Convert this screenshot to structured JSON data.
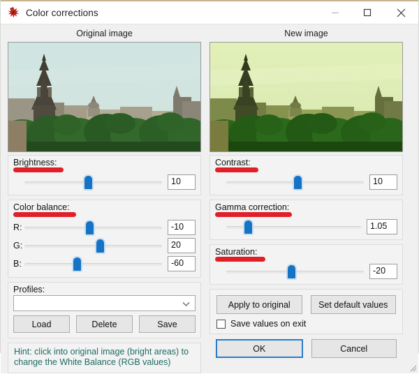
{
  "window": {
    "title": "Color corrections",
    "app_icon": "splat-icon",
    "minimize_label": "Minimize",
    "maximize_label": "Maximize",
    "close_label": "Close"
  },
  "previews": {
    "original_caption": "Original image",
    "new_caption": "New image"
  },
  "adjustments": {
    "brightness": {
      "label": "Brightness:",
      "value": "10",
      "thumb_pct": 46
    },
    "color_balance": {
      "label": "Color balance:",
      "channels": [
        {
          "label": "R:",
          "value": "-10",
          "thumb_pct": 47
        },
        {
          "label": "G:",
          "value": "20",
          "thumb_pct": 55
        },
        {
          "label": "B:",
          "value": "-60",
          "thumb_pct": 38
        }
      ]
    },
    "contrast": {
      "label": "Contrast:",
      "value": "10",
      "thumb_pct": 52
    },
    "gamma": {
      "label": "Gamma correction:",
      "value": "1.05",
      "thumb_pct": 16
    },
    "saturation": {
      "label": "Saturation:",
      "value": "-20",
      "thumb_pct": 47
    }
  },
  "profiles": {
    "label": "Profiles:",
    "selected": "",
    "placeholder": "",
    "load_label": "Load",
    "delete_label": "Delete",
    "save_label": "Save"
  },
  "hint": {
    "line1": "Hint: click into original image (bright areas) to",
    "line2": "change the White Balance (RGB values)",
    "color": "#1c6b63"
  },
  "actions": {
    "apply_label": "Apply to original",
    "defaults_label": "Set default values",
    "save_on_exit_label": "Save values on exit",
    "save_on_exit_checked": false,
    "ok_label": "OK",
    "cancel_label": "Cancel"
  },
  "colors": {
    "accent_red": "#e01f26",
    "slider_blue": "#1573c6",
    "focus_blue": "#2a7cc7",
    "hint_teal": "#1c6b63",
    "window_bg": "#f0f0f0",
    "title_accent": "#c9b58b"
  }
}
